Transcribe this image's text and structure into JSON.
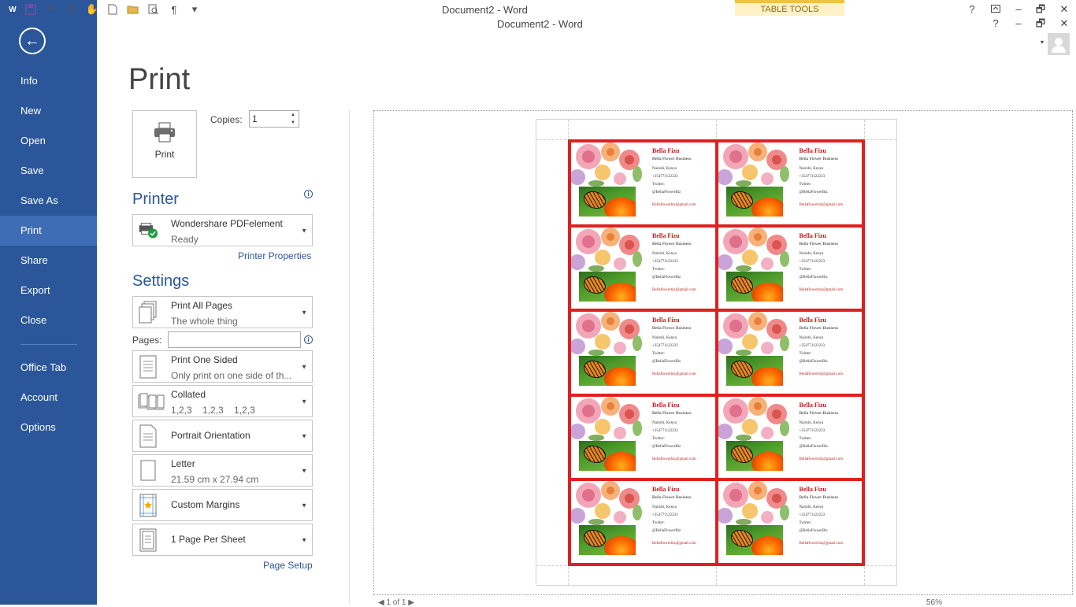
{
  "window": {
    "title_top": "Document2 - Word",
    "title_doc": "Document2 - Word",
    "contextual_tab": "TABLE TOOLS",
    "help": "?",
    "minimize": "–",
    "restore": "🗗",
    "close": "✕"
  },
  "sidebar": {
    "back": "←",
    "items": [
      {
        "label": "Info"
      },
      {
        "label": "New"
      },
      {
        "label": "Open"
      },
      {
        "label": "Save"
      },
      {
        "label": "Save As"
      },
      {
        "label": "Print"
      },
      {
        "label": "Share"
      },
      {
        "label": "Export"
      },
      {
        "label": "Close"
      },
      {
        "label": "Office Tab"
      },
      {
        "label": "Account"
      },
      {
        "label": "Options"
      }
    ],
    "active": "Print"
  },
  "print": {
    "heading": "Print",
    "button_label": "Print",
    "copies_label": "Copies:",
    "copies_value": "1"
  },
  "printer": {
    "heading": "Printer",
    "name": "Wondershare PDFelement",
    "status": "Ready",
    "properties_link": "Printer Properties"
  },
  "settings": {
    "heading": "Settings",
    "pages_label": "Pages:",
    "pages_value": "",
    "what": {
      "main": "Print All Pages",
      "sub": "The whole thing"
    },
    "sides": {
      "main": "Print One Sided",
      "sub": "Only print on one side of th..."
    },
    "collation": {
      "main": "Collated",
      "sub": "1,2,3    1,2,3    1,2,3"
    },
    "orientation": {
      "main": "Portrait Orientation"
    },
    "paper": {
      "main": "Letter",
      "sub": "21.59 cm x 27.94 cm"
    },
    "margins": {
      "main": "Custom Margins"
    },
    "per_sheet": {
      "main": "1 Page Per Sheet"
    },
    "page_setup_link": "Page Setup"
  },
  "card": {
    "name": "Bella Fizu",
    "business": "Bella Flower Business",
    "city": "Nairobi, Kenya",
    "phone": "+254771122233",
    "twitter_label": "Twitter:",
    "handle": "@BellaFlowerBiz",
    "email": "Bellaflowerbiz@gmail.com"
  },
  "colors": {
    "accent": "#2b579a",
    "card_border": "#e02020",
    "name_red": "#c41c1c"
  }
}
